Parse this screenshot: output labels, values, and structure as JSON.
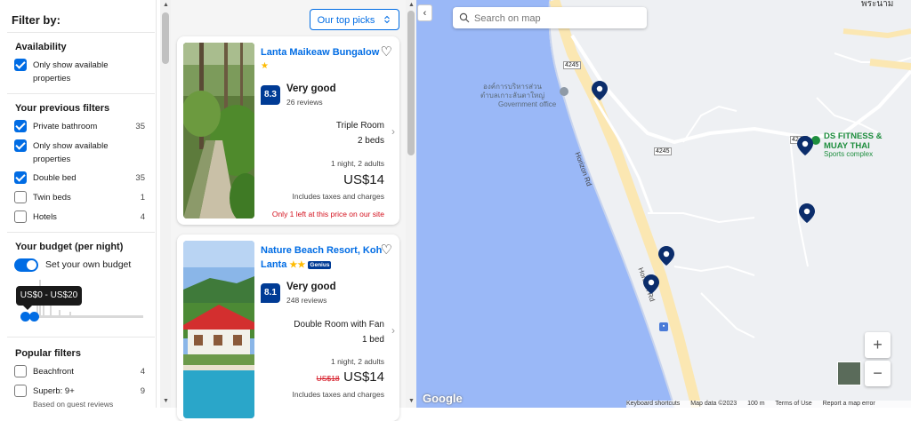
{
  "filters": {
    "title": "Filter by:",
    "availability": {
      "title": "Availability",
      "items": [
        {
          "label": "Only show available properties",
          "checked": true
        }
      ]
    },
    "previous": {
      "title": "Your previous filters",
      "items": [
        {
          "label": "Private bathroom",
          "count": "35",
          "checked": true
        },
        {
          "label": "Only show available properties",
          "count": "",
          "checked": true
        },
        {
          "label": "Double bed",
          "count": "35",
          "checked": true
        },
        {
          "label": "Twin beds",
          "count": "1",
          "checked": false
        },
        {
          "label": "Hotels",
          "count": "4",
          "checked": false
        }
      ]
    },
    "budget": {
      "title": "Your budget (per night)",
      "toggle_label": "Set your own budget",
      "toggle_on": true,
      "range_label": "US$0 - US$20"
    },
    "popular": {
      "title": "Popular filters",
      "items": [
        {
          "label": "Beachfront",
          "count": "4",
          "checked": false
        },
        {
          "label": "Superb: 9+",
          "count": "9",
          "checked": false,
          "sublabel": "Based on guest reviews"
        }
      ]
    }
  },
  "sort": {
    "label": "Our top picks",
    "icon": "sort-updown-icon"
  },
  "listings": [
    {
      "name": "Lanta Maikeaw Bungalow",
      "stars": 1,
      "score": "8.3",
      "score_word": "Very good",
      "reviews": "26 reviews",
      "room": "Triple Room",
      "beds": "2 beds",
      "stay": "1 night, 2 adults",
      "old_price": "",
      "price": "US$14",
      "taxes": "Includes taxes and charges",
      "alert": "Only 1 left at this price on our site"
    },
    {
      "name": "Nature Beach Resort, Koh Lanta",
      "stars": 2,
      "badge": "Genius",
      "score": "8.1",
      "score_word": "Very good",
      "reviews": "248 reviews",
      "room": "Double Room with Fan",
      "beds": "1 bed",
      "stay": "1 night, 2 adults",
      "old_price": "US$18",
      "price": "US$14",
      "taxes": "Includes taxes and charges",
      "alert": ""
    }
  ],
  "map": {
    "search_placeholder": "Search on map",
    "labels": {
      "govt_thai": "องค์การบริหารส่วน\nตำบลเกาะลันตาใหญ่",
      "govt_en": "Government office",
      "fitness_1": "DS FITNESS &",
      "fitness_2": "MUAY THAI",
      "fitness_sub": "Sports complex",
      "road_1": "Horizon Rd",
      "road_2": "Horizon Rd",
      "route_a": "4245",
      "route_b": "4245",
      "route_c": "4245",
      "top_right": "พระนาม"
    },
    "zoom_in": "+",
    "zoom_out": "−",
    "google": "Google",
    "attribution": [
      "Keyboard shortcuts",
      "Map data ©2023",
      "100 m",
      "Terms of Use",
      "Report a map error"
    ],
    "colors": {
      "water": "#9ab8f7",
      "land": "#eef0f3",
      "road_major": "#fbe7b2",
      "pin": "#0b2d6b",
      "poi_green": "#1e8e3e"
    }
  }
}
